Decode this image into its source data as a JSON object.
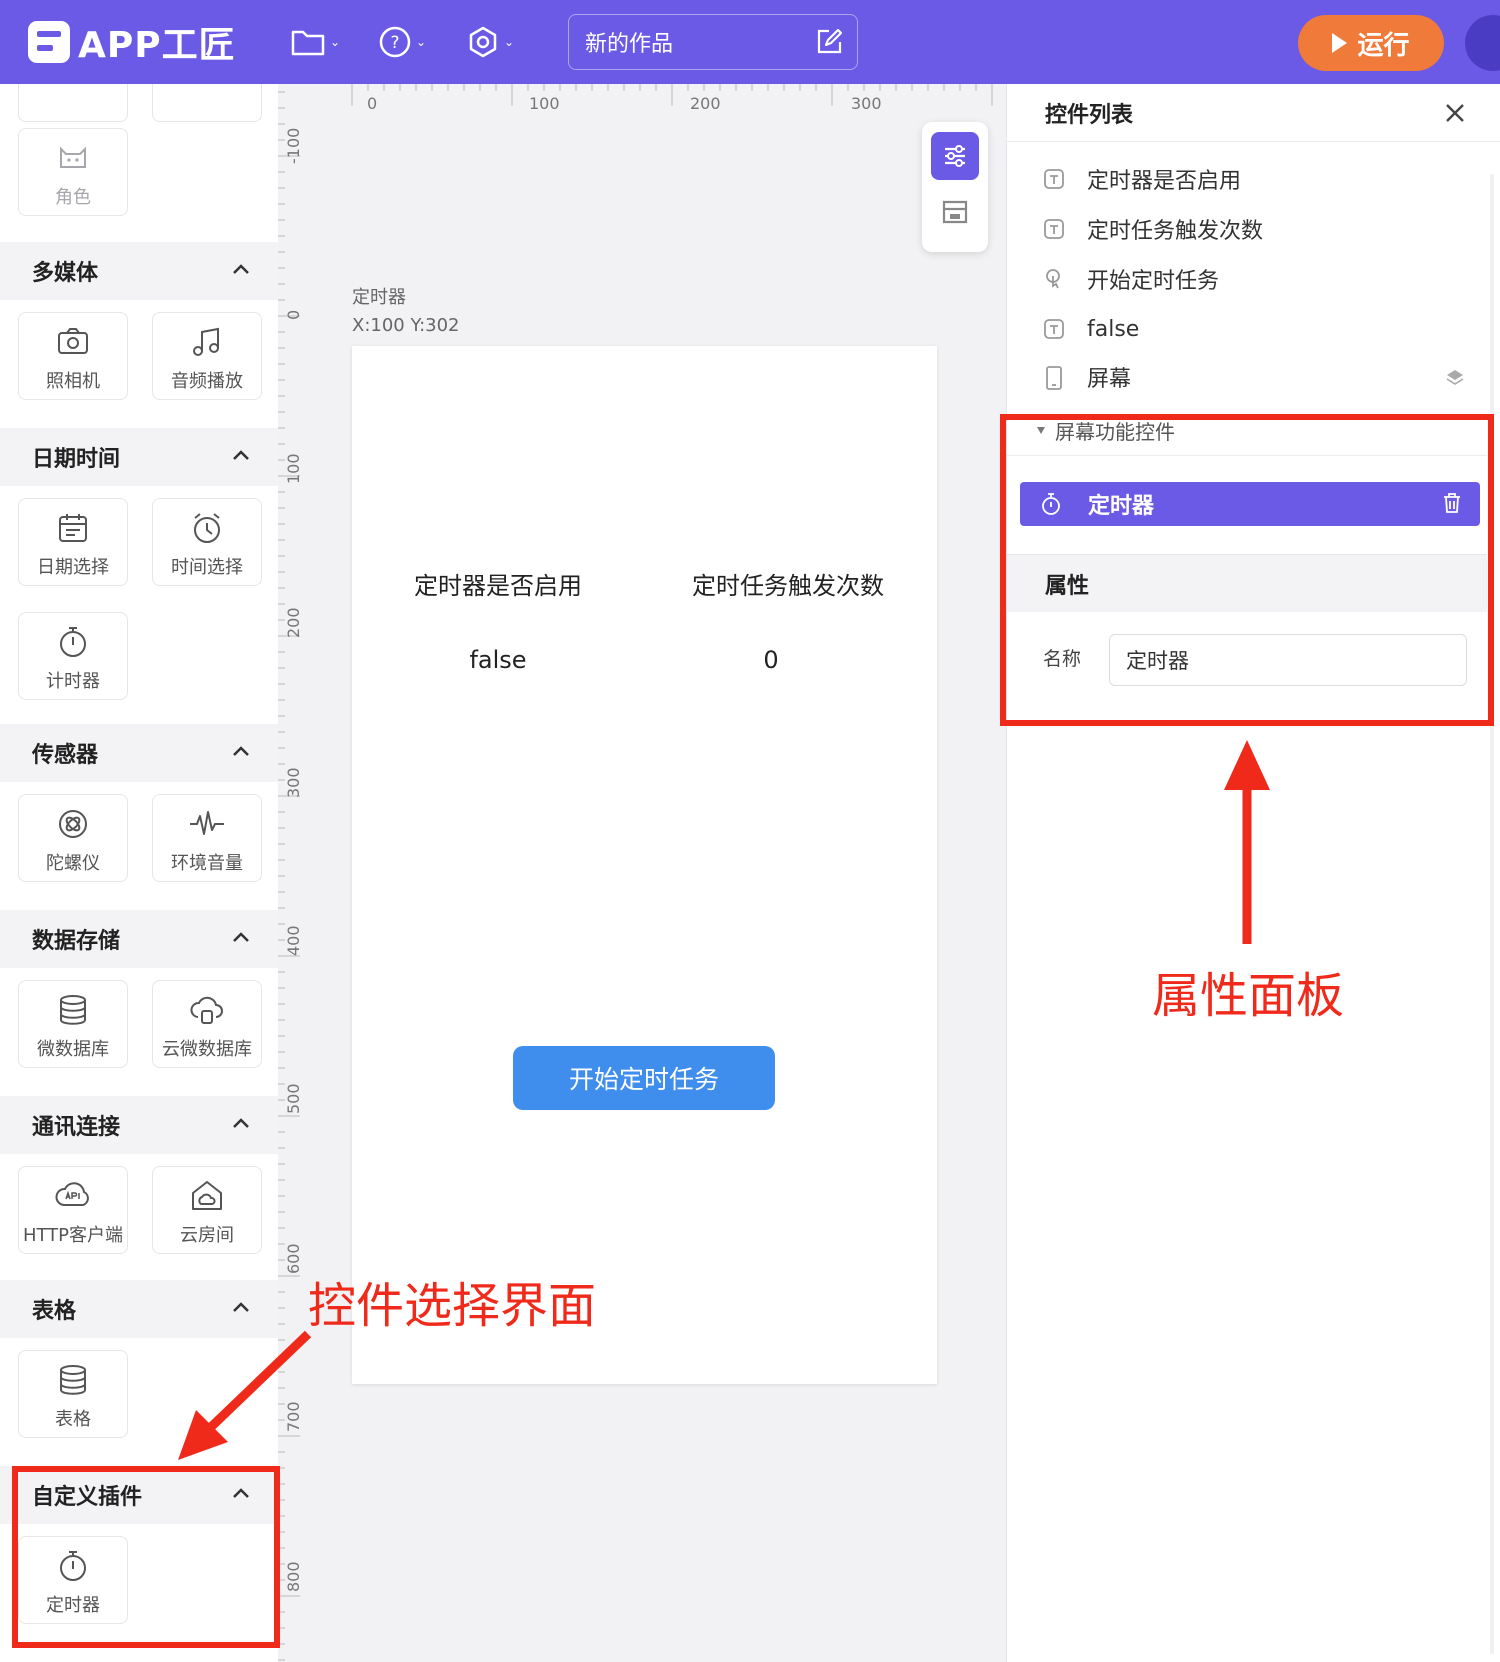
{
  "topbar": {
    "logo_text": "APP工匠",
    "project_name": "新的作品",
    "run_label": "运行"
  },
  "sidebar": {
    "top_tile": {
      "label": "角色",
      "icon": "cat-icon"
    },
    "categories": [
      {
        "title": "多媒体",
        "items": [
          {
            "label": "照相机",
            "icon": "camera-icon"
          },
          {
            "label": "音频播放",
            "icon": "music-icon"
          }
        ]
      },
      {
        "title": "日期时间",
        "items": [
          {
            "label": "日期选择",
            "icon": "calendar-icon"
          },
          {
            "label": "时间选择",
            "icon": "alarm-clock-icon"
          },
          {
            "label": "计时器",
            "icon": "stopwatch-icon"
          }
        ]
      },
      {
        "title": "传感器",
        "items": [
          {
            "label": "陀螺仪",
            "icon": "gyroscope-icon"
          },
          {
            "label": "环境音量",
            "icon": "waveform-icon"
          }
        ]
      },
      {
        "title": "数据存储",
        "items": [
          {
            "label": "微数据库",
            "icon": "database-icon"
          },
          {
            "label": "云微数据库",
            "icon": "cloud-database-icon"
          }
        ]
      },
      {
        "title": "通讯连接",
        "items": [
          {
            "label": "HTTP客户端",
            "icon": "cloud-api-icon"
          },
          {
            "label": "云房间",
            "icon": "cloud-house-icon"
          }
        ]
      },
      {
        "title": "表格",
        "items": [
          {
            "label": "表格",
            "icon": "database-icon"
          }
        ]
      },
      {
        "title": "自定义插件",
        "items": [
          {
            "label": "定时器",
            "icon": "stopwatch-icon"
          }
        ]
      }
    ]
  },
  "canvas": {
    "ruler_top": [
      "0",
      "100",
      "200",
      "300"
    ],
    "ruler_left": [
      "-100",
      "0",
      "100",
      "200",
      "300",
      "400",
      "500",
      "600",
      "700",
      "800"
    ],
    "selection_name": "定时器",
    "selection_coords": "X:100 Y:302",
    "phone": {
      "label_enabled": "定时器是否启用",
      "label_count": "定时任务触发次数",
      "value_enabled": "false",
      "value_count": "0",
      "button_label": "开始定时任务"
    }
  },
  "right_panel": {
    "title": "控件列表",
    "items": [
      {
        "label": "定时器是否启用",
        "icon": "text-box-icon"
      },
      {
        "label": "定时任务触发次数",
        "icon": "text-box-icon"
      },
      {
        "label": "开始定时任务",
        "icon": "button-tap-icon"
      },
      {
        "label": "false",
        "icon": "text-box-icon"
      },
      {
        "label": "屏幕",
        "icon": "phone-icon"
      }
    ],
    "group_label": "屏幕功能控件",
    "selected_item": "定时器",
    "properties_title": "属性",
    "name_label": "名称",
    "name_value": "定时器"
  },
  "annotations": {
    "property_panel": "属性面板",
    "control_selection": "控件选择界面"
  },
  "colors": {
    "brand": "#6b5ae6",
    "run_button": "#f07a3a",
    "phone_button": "#3f8ded",
    "annotation": "#f02a1b"
  }
}
